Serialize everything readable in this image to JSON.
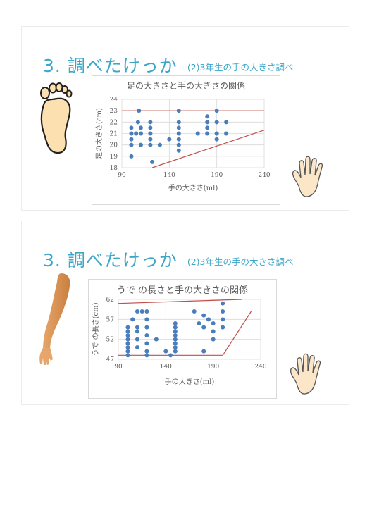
{
  "slides": [
    {
      "title_main": "3. 調べたけっか",
      "title_sub": "(2)3年生の手の大きさ調べ"
    },
    {
      "title_main": "3. 調べたけっか",
      "title_sub": "(2)3年生の手の大きさ調べ"
    }
  ],
  "chart_data": [
    {
      "type": "scatter",
      "title": "足の大きさと手の大きさの関係",
      "xlabel": "手の大きさ(ml)",
      "ylabel": "足の大きさ(cm)",
      "xlim": [
        90,
        240
      ],
      "ylim": [
        18,
        24
      ],
      "x_ticks": [
        90,
        140,
        190,
        240
      ],
      "y_ticks": [
        18,
        19,
        20,
        21,
        22,
        23,
        24
      ],
      "grid": true,
      "points": [
        [
          100,
          19
        ],
        [
          100,
          20.5
        ],
        [
          100,
          21
        ],
        [
          100,
          21.5
        ],
        [
          100,
          20
        ],
        [
          105,
          21
        ],
        [
          107,
          22
        ],
        [
          108,
          23
        ],
        [
          110,
          21
        ],
        [
          110,
          20
        ],
        [
          110,
          21.5
        ],
        [
          120,
          22
        ],
        [
          120,
          21
        ],
        [
          120,
          20.5
        ],
        [
          120,
          20
        ],
        [
          120,
          21.5
        ],
        [
          122,
          18.5
        ],
        [
          130,
          20
        ],
        [
          140,
          20.5
        ],
        [
          150,
          23
        ],
        [
          150,
          22
        ],
        [
          150,
          21.5
        ],
        [
          150,
          21
        ],
        [
          150,
          20.5
        ],
        [
          150,
          20
        ],
        [
          150,
          19.5
        ],
        [
          170,
          21
        ],
        [
          180,
          22.5
        ],
        [
          180,
          21.5
        ],
        [
          180,
          21
        ],
        [
          180,
          22
        ],
        [
          190,
          23
        ],
        [
          190,
          22
        ],
        [
          190,
          21
        ],
        [
          190,
          20.5
        ],
        [
          200,
          22
        ],
        [
          200,
          21
        ]
      ],
      "lines": [
        {
          "x": [
            90,
            240
          ],
          "y": [
            23,
            23
          ],
          "color": "#c0504d"
        },
        {
          "x": [
            122,
            240
          ],
          "y": [
            18,
            21.3
          ],
          "color": "#c0504d"
        }
      ]
    },
    {
      "type": "scatter",
      "title": "うで の長さと手の大きさの関係",
      "xlabel": "手の大きさ(ml)",
      "ylabel": "うで の長さ(cm)",
      "xlim": [
        90,
        240
      ],
      "ylim": [
        47,
        62
      ],
      "x_ticks": [
        90,
        140,
        190,
        240
      ],
      "y_ticks": [
        47,
        52,
        57,
        62
      ],
      "grid": true,
      "points": [
        [
          100,
          48
        ],
        [
          100,
          49
        ],
        [
          100,
          50
        ],
        [
          100,
          51
        ],
        [
          100,
          52
        ],
        [
          100,
          53
        ],
        [
          100,
          54
        ],
        [
          100,
          55
        ],
        [
          105,
          57
        ],
        [
          110,
          59
        ],
        [
          110,
          55
        ],
        [
          110,
          54
        ],
        [
          110,
          52
        ],
        [
          110,
          50
        ],
        [
          115,
          59
        ],
        [
          120,
          59
        ],
        [
          120,
          57
        ],
        [
          120,
          55
        ],
        [
          120,
          53
        ],
        [
          120,
          51
        ],
        [
          120,
          49
        ],
        [
          120,
          48
        ],
        [
          130,
          52
        ],
        [
          140,
          49
        ],
        [
          145,
          48
        ],
        [
          150,
          49
        ],
        [
          150,
          50
        ],
        [
          150,
          51
        ],
        [
          150,
          52
        ],
        [
          150,
          53
        ],
        [
          150,
          54
        ],
        [
          150,
          55
        ],
        [
          150,
          56
        ],
        [
          170,
          59
        ],
        [
          175,
          56
        ],
        [
          180,
          58
        ],
        [
          180,
          55
        ],
        [
          180,
          49
        ],
        [
          185,
          57
        ],
        [
          190,
          56
        ],
        [
          190,
          54
        ],
        [
          190,
          52
        ],
        [
          200,
          61
        ],
        [
          200,
          59
        ],
        [
          200,
          57
        ],
        [
          200,
          55
        ]
      ],
      "lines": [
        {
          "x": [
            90,
            220
          ],
          "y": [
            61,
            62
          ],
          "color": "#c0504d"
        },
        {
          "x": [
            90,
            200
          ],
          "y": [
            48,
            48
          ],
          "color": "#c0504d"
        },
        {
          "x": [
            200,
            230
          ],
          "y": [
            48,
            59
          ],
          "color": "#c0504d"
        }
      ]
    }
  ],
  "images": {
    "slide1_left": "footprint-icon",
    "slide2_left": "arm-icon",
    "slide_right": "open-hand-icon"
  },
  "colors": {
    "title": "#3aa6c8",
    "point": "#4a7ebb",
    "line": "#c0504d",
    "grid": "#d9d9d9"
  }
}
